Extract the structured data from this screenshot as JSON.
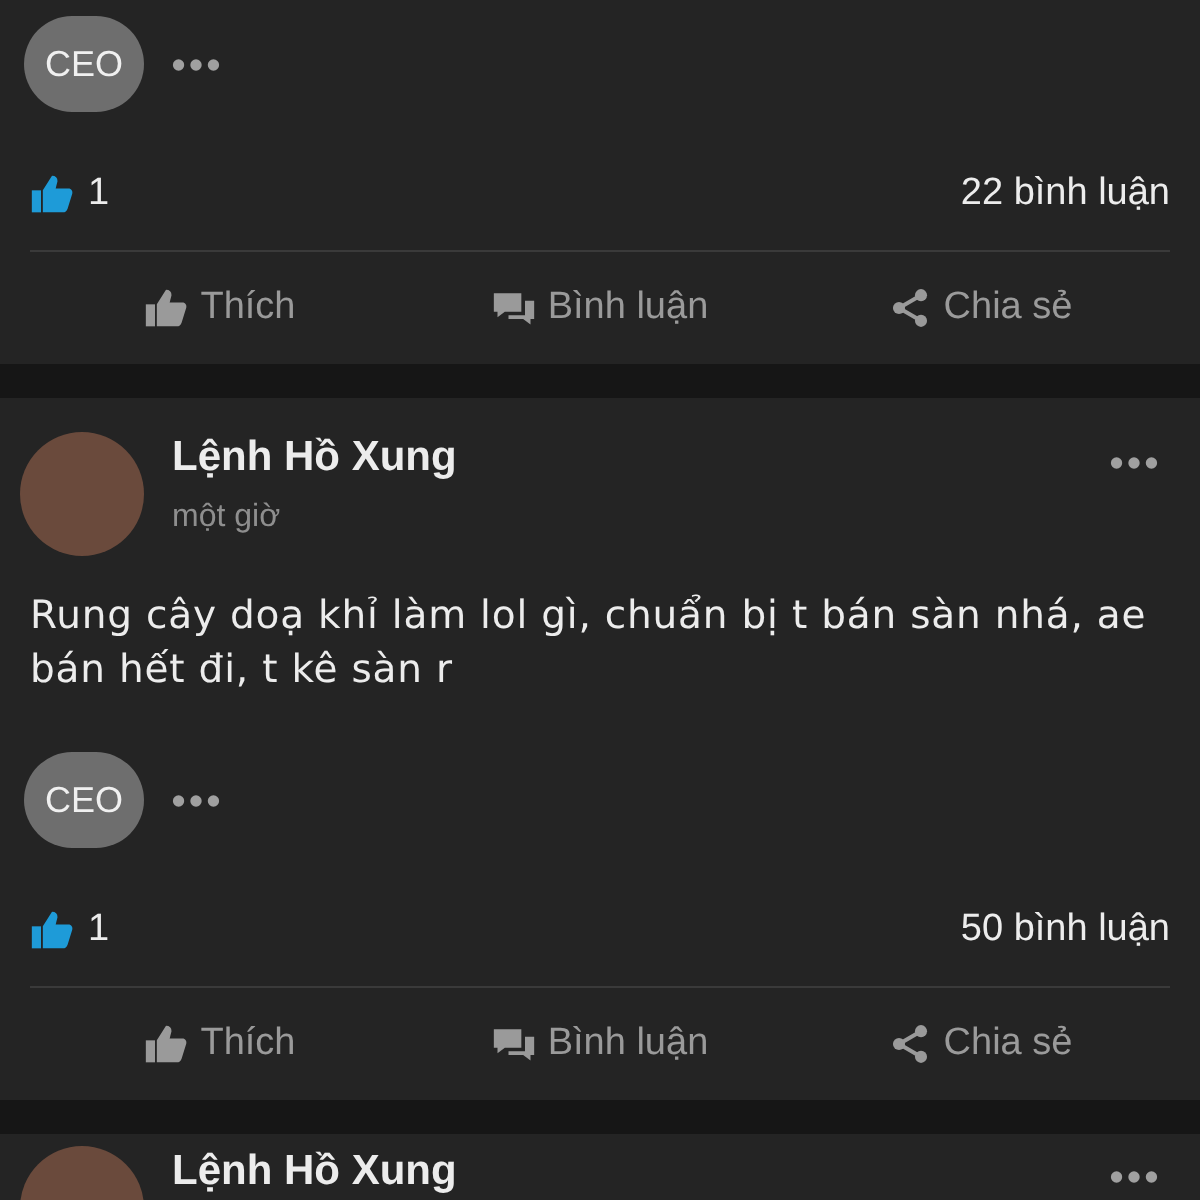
{
  "posts": [
    {
      "tag": "CEO",
      "likes": "1",
      "comments": "22 bình luận",
      "actions": [
        "Thích",
        "Bình luận",
        "Chia sẻ"
      ]
    },
    {
      "author": "Lệnh Hồ Xung",
      "time": "một giờ",
      "text": "Rung cây doạ khỉ làm lol gì, chuẩn bị t bán sàn nhá, ae bán hết đi, t kê sàn r",
      "tag": "CEO",
      "likes": "1",
      "comments": "50 bình luận",
      "actions": [
        "Thích",
        "Bình luận",
        "Chia sẻ"
      ]
    },
    {
      "author": "Lệnh Hồ Xung"
    }
  ]
}
